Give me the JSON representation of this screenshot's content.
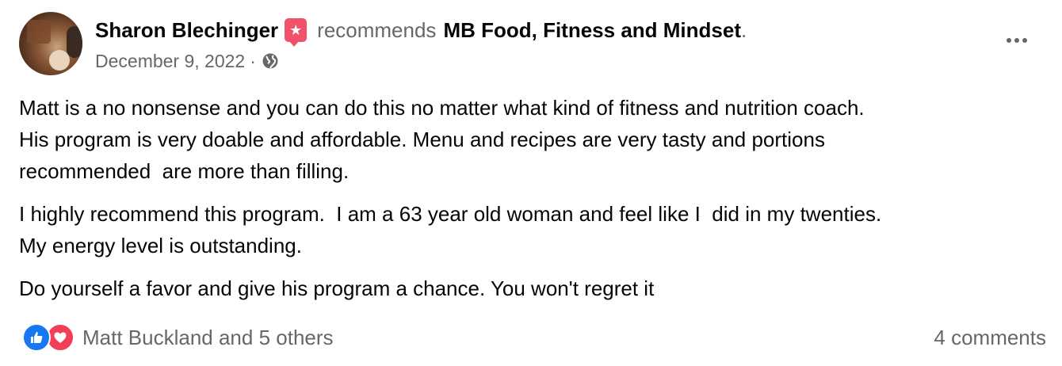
{
  "author": {
    "name": "Sharon Blechinger",
    "action": "recommends",
    "page": "MB Food, Fitness and Mindset",
    "period": "."
  },
  "meta": {
    "date": "December 9, 2022",
    "separator": "·",
    "privacy_icon": "globe-icon"
  },
  "body": {
    "paragraphs": [
      "Matt is a no nonsense and you can do this no matter what kind of fitness and nutrition coach.\nHis program is very doable and affordable. Menu and recipes are very tasty and portions\nrecommended  are more than filling.",
      "I highly recommend this program.  I am a 63 year old woman and feel like I  did in my twenties.\nMy energy level is outstanding.",
      "Do yourself a favor and give his program a chance. You won't regret it"
    ]
  },
  "reactions": {
    "icons": [
      "like-icon",
      "love-icon"
    ],
    "summary": "Matt Buckland and 5 others"
  },
  "comments": {
    "count_label": "4 comments"
  },
  "colors": {
    "text_primary": "#050505",
    "text_secondary": "#65676b",
    "recommend_badge": "#f0526b",
    "like": "#1877f2",
    "love": "#f33e58"
  }
}
